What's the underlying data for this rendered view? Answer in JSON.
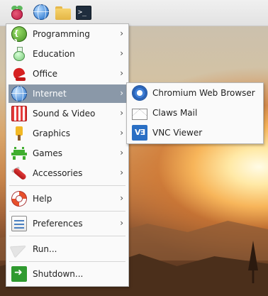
{
  "taskbar": {
    "icons": [
      "raspberry-pi-menu-icon",
      "web-browser-icon",
      "file-manager-icon",
      "terminal-icon"
    ],
    "terminal_glyph": ">_"
  },
  "menu": {
    "items": [
      {
        "label": "Programming",
        "icon": "programming-icon",
        "has_submenu": true
      },
      {
        "label": "Education",
        "icon": "education-icon",
        "has_submenu": true
      },
      {
        "label": "Office",
        "icon": "office-icon",
        "has_submenu": true
      },
      {
        "label": "Internet",
        "icon": "internet-icon",
        "has_submenu": true,
        "highlighted": true
      },
      {
        "label": "Sound & Video",
        "icon": "sound-video-icon",
        "has_submenu": true
      },
      {
        "label": "Graphics",
        "icon": "graphics-icon",
        "has_submenu": true
      },
      {
        "label": "Games",
        "icon": "games-icon",
        "has_submenu": true
      },
      {
        "label": "Accessories",
        "icon": "accessories-icon",
        "has_submenu": true
      },
      {
        "label": "Help",
        "icon": "help-icon",
        "has_submenu": true
      },
      {
        "label": "Preferences",
        "icon": "preferences-icon",
        "has_submenu": true
      },
      {
        "label": "Run...",
        "icon": "run-icon",
        "has_submenu": false
      },
      {
        "label": "Shutdown...",
        "icon": "shutdown-icon",
        "has_submenu": false
      }
    ],
    "arrow": "›"
  },
  "submenu": {
    "parent": "Internet",
    "items": [
      {
        "label": "Chromium Web Browser",
        "icon": "chromium-icon"
      },
      {
        "label": "Claws Mail",
        "icon": "mail-icon"
      },
      {
        "label": "VNC Viewer",
        "icon": "vnc-viewer-icon",
        "glyph": "VƎ"
      }
    ]
  },
  "colors": {
    "highlight": "#8a98a8",
    "menu_background": "#fafafa",
    "taskbar": "#e8e8e8"
  }
}
